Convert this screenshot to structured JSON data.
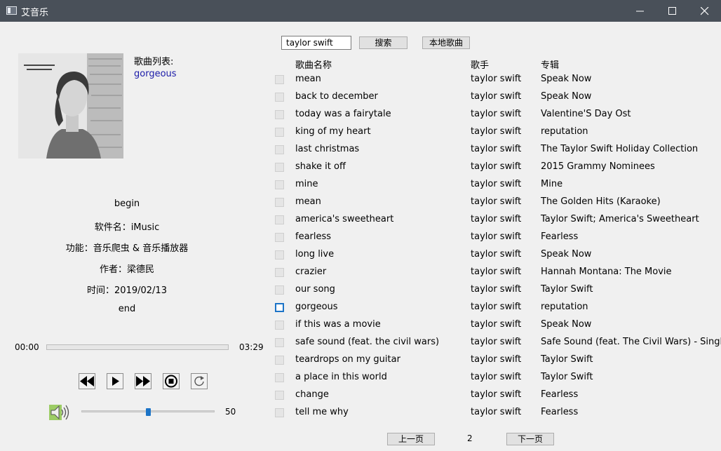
{
  "window": {
    "title": "艾音乐"
  },
  "sidebar": {
    "list_label": "歌曲列表:",
    "current_song": "gorgeous",
    "info_lines": [
      "begin",
      "软件名：iMusic",
      "功能：音乐爬虫 & 音乐播放器",
      "作者：梁德民",
      "时间：2019/02/13",
      "end"
    ]
  },
  "player": {
    "time_elapsed": "00:00",
    "time_total": "03:29",
    "progress": 0,
    "volume": "50",
    "volume_fraction": 0.5
  },
  "toolbar": {
    "search_value": "taylor swift",
    "search_label": "搜索",
    "local_label": "本地歌曲"
  },
  "table": {
    "headers": [
      "歌曲名称",
      "歌手",
      "专辑"
    ],
    "rows": [
      [
        "mean",
        "taylor swift",
        "Speak Now"
      ],
      [
        "back to december",
        "taylor swift",
        "Speak Now"
      ],
      [
        "today was a fairytale",
        "taylor swift",
        "Valentine'S Day Ost"
      ],
      [
        "king of my heart",
        "taylor swift",
        "reputation"
      ],
      [
        "last christmas",
        "taylor swift",
        "The Taylor Swift Holiday Collection"
      ],
      [
        "shake it off",
        "taylor swift",
        "2015 Grammy Nominees"
      ],
      [
        "mine",
        "taylor swift",
        "Mine"
      ],
      [
        "mean",
        "taylor swift",
        "The Golden Hits (Karaoke)"
      ],
      [
        "america's sweetheart",
        "taylor swift",
        "Taylor Swift; America's Sweetheart"
      ],
      [
        "fearless",
        "taylor swift",
        "Fearless"
      ],
      [
        "long live",
        "taylor swift",
        "Speak Now"
      ],
      [
        "crazier",
        "taylor swift",
        "Hannah Montana: The Movie"
      ],
      [
        "our song",
        "taylor swift",
        "Taylor Swift"
      ],
      [
        "gorgeous",
        "taylor swift",
        "reputation"
      ],
      [
        "if this was a movie",
        "taylor swift",
        "Speak Now"
      ],
      [
        "safe  sound (feat. the civil wars)",
        "taylor swift",
        "Safe  Sound (feat. The Civil Wars) - Single"
      ],
      [
        "teardrops on my guitar",
        "taylor swift",
        "Taylor Swift"
      ],
      [
        "a place in this world",
        "taylor swift",
        "Taylor Swift"
      ],
      [
        "change",
        "taylor swift",
        "Fearless"
      ],
      [
        "tell me why",
        "taylor swift",
        "Fearless"
      ]
    ],
    "focused_row": 13
  },
  "pagination": {
    "prev_label": "上一页",
    "page": "2",
    "next_label": "下一页"
  },
  "icons": {
    "app": "app-window-icon",
    "minimize": "minimize-icon",
    "maximize": "maximize-icon",
    "close": "close-icon",
    "prev": "previous-track-icon",
    "play": "play-icon",
    "next": "next-track-icon",
    "stop": "stop-icon",
    "loop": "repeat-icon",
    "volume": "speaker-icon"
  },
  "colors": {
    "titlebar": "#495059",
    "accent": "#1c74c7",
    "current_song": "#1a1aa8"
  }
}
